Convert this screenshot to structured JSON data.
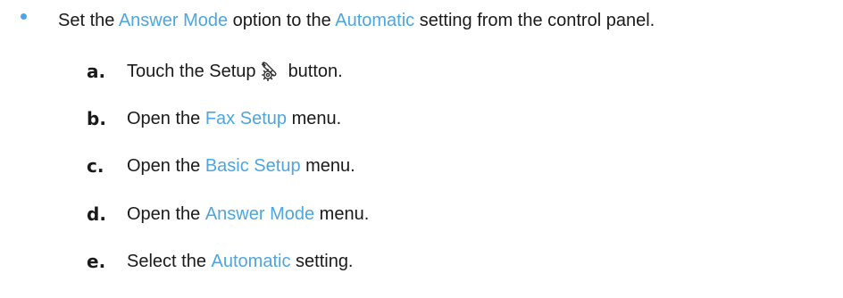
{
  "bullet": {
    "pre": "Set the ",
    "link1": "Answer Mode",
    "mid": " option to the ",
    "link2": "Automatic",
    "post": " setting from the control panel."
  },
  "steps": [
    {
      "letter": "a.",
      "pre": "Touch the Setup",
      "icon": "setup-wrench-gear-icon",
      "post": "button."
    },
    {
      "letter": "b.",
      "pre": "Open the ",
      "link": "Fax Setup",
      "post": " menu."
    },
    {
      "letter": "c.",
      "pre": "Open the ",
      "link": "Basic Setup",
      "post": " menu."
    },
    {
      "letter": "d.",
      "pre": "Open the ",
      "link": "Answer Mode",
      "post": " menu."
    },
    {
      "letter": "e.",
      "pre": "Select the ",
      "link": "Automatic",
      "post": " setting."
    }
  ],
  "colors": {
    "accent": "#4da6e0",
    "text": "#1a1a1a"
  }
}
